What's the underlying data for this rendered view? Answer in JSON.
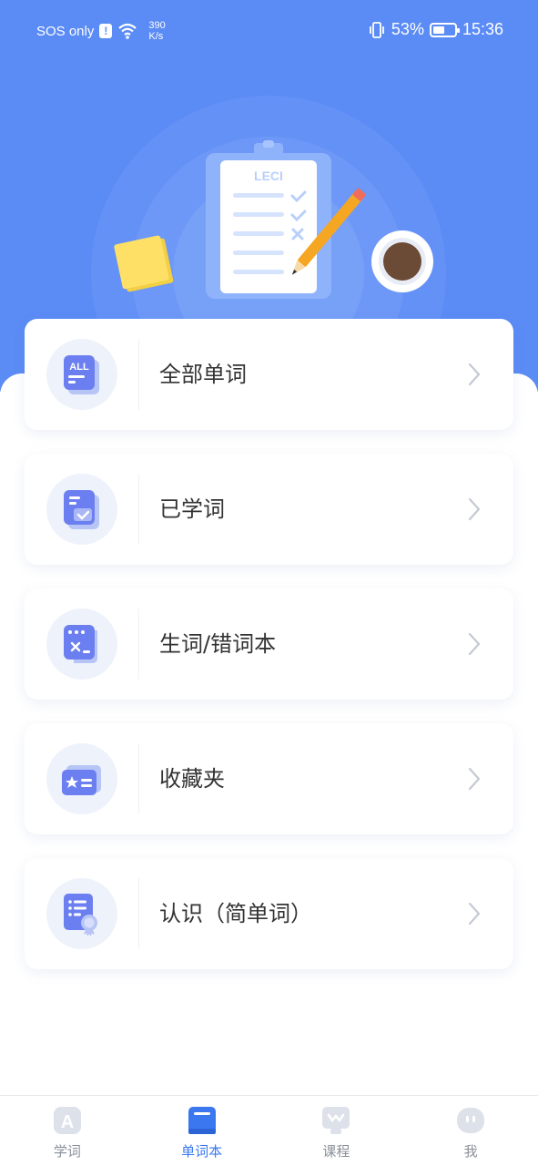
{
  "status_bar": {
    "carrier": "SOS only",
    "alert_glyph": "!",
    "net_speed_value": "390",
    "net_speed_unit": "K/s",
    "battery_percent": "53%",
    "battery_level": 0.53,
    "time": "15:36"
  },
  "hero": {
    "clipboard_brand": "LECI",
    "background_color": "#5b8bf5"
  },
  "menu": [
    {
      "label": "全部单词",
      "icon": "all-words-icon"
    },
    {
      "label": "已学词",
      "icon": "learned-words-icon"
    },
    {
      "label": "生词/错词本",
      "icon": "mistake-words-icon"
    },
    {
      "label": "收藏夹",
      "icon": "favorites-icon"
    },
    {
      "label": "认识（简单词）",
      "icon": "known-words-icon"
    }
  ],
  "tabbar": {
    "items": [
      {
        "label": "学词",
        "icon": "study-icon",
        "active": false
      },
      {
        "label": "单词本",
        "icon": "wordbook-icon",
        "active": true
      },
      {
        "label": "课程",
        "icon": "course-icon",
        "active": false
      },
      {
        "label": "我",
        "icon": "profile-icon",
        "active": false
      }
    ],
    "active_color": "#3b78f0",
    "inactive_color": "#8a8f99"
  }
}
